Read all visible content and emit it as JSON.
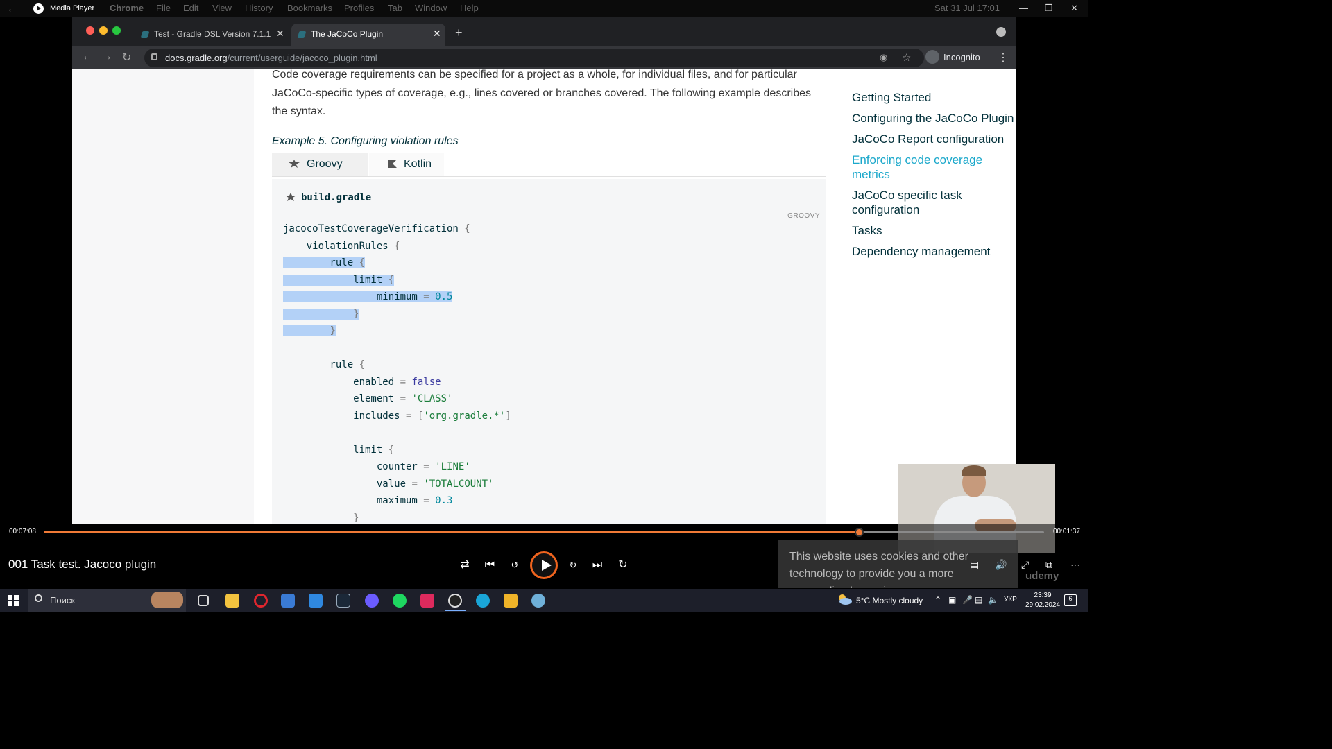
{
  "media_player": {
    "app_title": "Media Player",
    "media_title": "001 Task test. Jacoco plugin",
    "time_current": "00:07:08",
    "time_remaining": "00:01:37",
    "progress_fraction": 0.815
  },
  "mac_menubar": {
    "items": [
      "Chrome",
      "File",
      "Edit",
      "View",
      "History",
      "Bookmarks",
      "Profiles",
      "Tab",
      "Window",
      "Help"
    ],
    "datetime": "Sat 31 Jul  17:01"
  },
  "browser": {
    "tabs": [
      {
        "label": "Test - Gradle DSL Version 7.1.1",
        "active": false
      },
      {
        "label": "The JaCoCo Plugin",
        "active": true
      }
    ],
    "url_host": "docs.gradle.org",
    "url_path": "/current/userguide/jacoco_plugin.html",
    "profile_label": "Incognito"
  },
  "doc": {
    "intro_text": "Code coverage requirements can be specified for a project as a whole, for individual files, and for particular JaCoCo-specific types of coverage, e.g., lines covered or branches covered. The following example describes the syntax.",
    "example_title": "Example 5. Configuring violation rules",
    "code_tabs": [
      "Groovy",
      "Kotlin"
    ],
    "file_name": "build.gradle",
    "code_lang": "GROOVY",
    "code_lines": [
      "jacocoTestCoverageVerification {",
      "    violationRules {",
      "        rule {",
      "            limit {",
      "                minimum = 0.5",
      "            }",
      "        }",
      "",
      "        rule {",
      "            enabled = false",
      "            element = 'CLASS'",
      "            includes = ['org.gradle.*']",
      "",
      "            limit {",
      "                counter = 'LINE'",
      "                value = 'TOTALCOUNT'",
      "                maximum = 0.3",
      "            }",
      "        }",
      "    }",
      "}"
    ],
    "toc": [
      {
        "label": "Getting Started",
        "active": false
      },
      {
        "label": "Configuring the JaCoCo Plugin",
        "active": false
      },
      {
        "label": "JaCoCo Report configuration",
        "active": false
      },
      {
        "label": "Enforcing code coverage metrics",
        "active": true
      },
      {
        "label": "JaCoCo specific task configuration",
        "active": false
      },
      {
        "label": "Tasks",
        "active": false
      },
      {
        "label": "Dependency management",
        "active": false
      }
    ],
    "cookie_text": "This website uses cookies and other technology to provide you a more personalized experience",
    "watermark": "udemy"
  },
  "taskbar": {
    "search_placeholder": "Поиск",
    "weather": "5°C  Mostly cloudy",
    "language": "УКР",
    "time": "23:39",
    "date": "29.02.2024",
    "notifications_count": "6"
  },
  "colors": {
    "accent_orange": "#f07a36",
    "toc_active": "#1ba8cb",
    "selection": "#b3d1f7"
  }
}
